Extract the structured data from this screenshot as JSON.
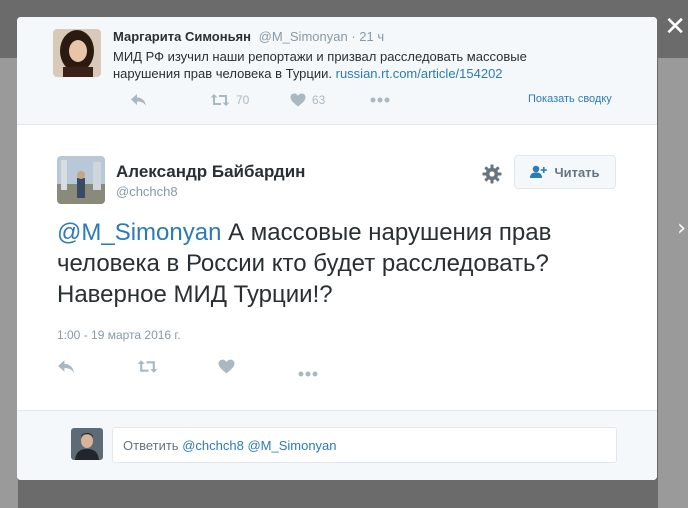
{
  "parent_tweet": {
    "name": "Маргарита Симоньян",
    "handle": "@M_Simonyan",
    "time_sep": "·",
    "time": "21 ч",
    "text_before_link": "МИД РФ изучил наши репортажи и призвал расследовать массовые нарушения прав человека в Турции.",
    "link": "russian.rt.com/article/154202",
    "retweets": "70",
    "likes": "63",
    "show_summary": "Показать сводку"
  },
  "main_tweet": {
    "name": "Александр Байбардин",
    "handle": "@chchch8",
    "follow_label": "Читать",
    "mention": "@M_Simonyan",
    "text": "А массовые нарушения прав человека в России кто будет расследовать? Наверное МИД Турции!?",
    "date": "1:00 - 19 марта 2016 г."
  },
  "reply": {
    "prefix": "Ответить",
    "mention1": "@chchch8",
    "mention2": "@M_Simonyan"
  },
  "icons": {
    "close": "close-icon",
    "next": "chevron-right-icon",
    "reply": "reply-icon",
    "retweet": "retweet-icon",
    "like": "heart-icon",
    "more": "more-icon",
    "gear": "gear-icon",
    "follow": "follow-icon"
  },
  "colors": {
    "link": "#2b7bb9",
    "muted": "#8899a6",
    "icon": "#aab8c2"
  }
}
